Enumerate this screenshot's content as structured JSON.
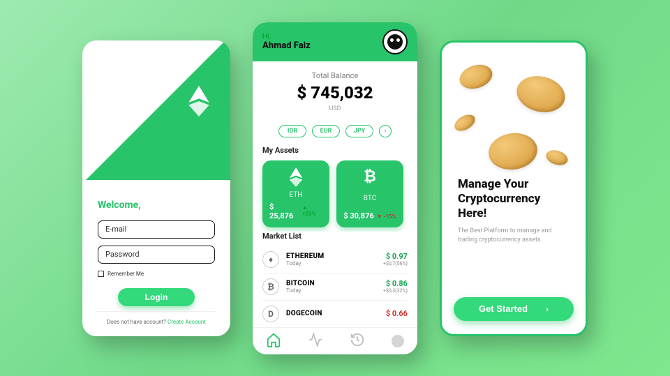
{
  "colors": {
    "accent": "#27c46a"
  },
  "login": {
    "welcome": "Welcome,",
    "email_placeholder": "E-mail",
    "password_placeholder": "Password",
    "remember": "Remember Me",
    "button": "Login",
    "footer_prompt": "Does not have account? ",
    "footer_link": "Create Account"
  },
  "home": {
    "hi": "Hi,",
    "username": "Ahmad Faiz",
    "balance_label": "Total Balance",
    "balance_amount": "$ 745,032",
    "balance_currency": "USD",
    "currencies": [
      "IDR",
      "EUR",
      "JPY"
    ],
    "assets_title": "My Assets",
    "assets": [
      {
        "symbol": "ETH",
        "price": "$ 25,876",
        "delta": "+25%",
        "dir": "up",
        "icon": "eth-icon"
      },
      {
        "symbol": "BTC",
        "price": "$ 30,876",
        "delta": "-15%",
        "dir": "down",
        "icon": "btc-icon"
      }
    ],
    "market_title": "Market List",
    "market": [
      {
        "name": "ETHEREUM",
        "sub": "Today",
        "price": "$ 0.97",
        "change": "+$0,7(56%)",
        "dir": "pos",
        "glyph": "♦"
      },
      {
        "name": "BITCOIN",
        "sub": "Today",
        "price": "$ 0.86",
        "change": "+$0,3(32%)",
        "dir": "pos",
        "glyph": "₿"
      },
      {
        "name": "DOGECOIN",
        "sub": "Today",
        "price": "$ 0.66",
        "change": "",
        "dir": "neg",
        "glyph": "D"
      }
    ]
  },
  "onboarding": {
    "heading_l1": "Manage Your",
    "heading_l2": "Cryptocurrency Here!",
    "sub": "The Best Platform to manage and trading cryptocurrency assets.",
    "cta": "Get Started"
  }
}
